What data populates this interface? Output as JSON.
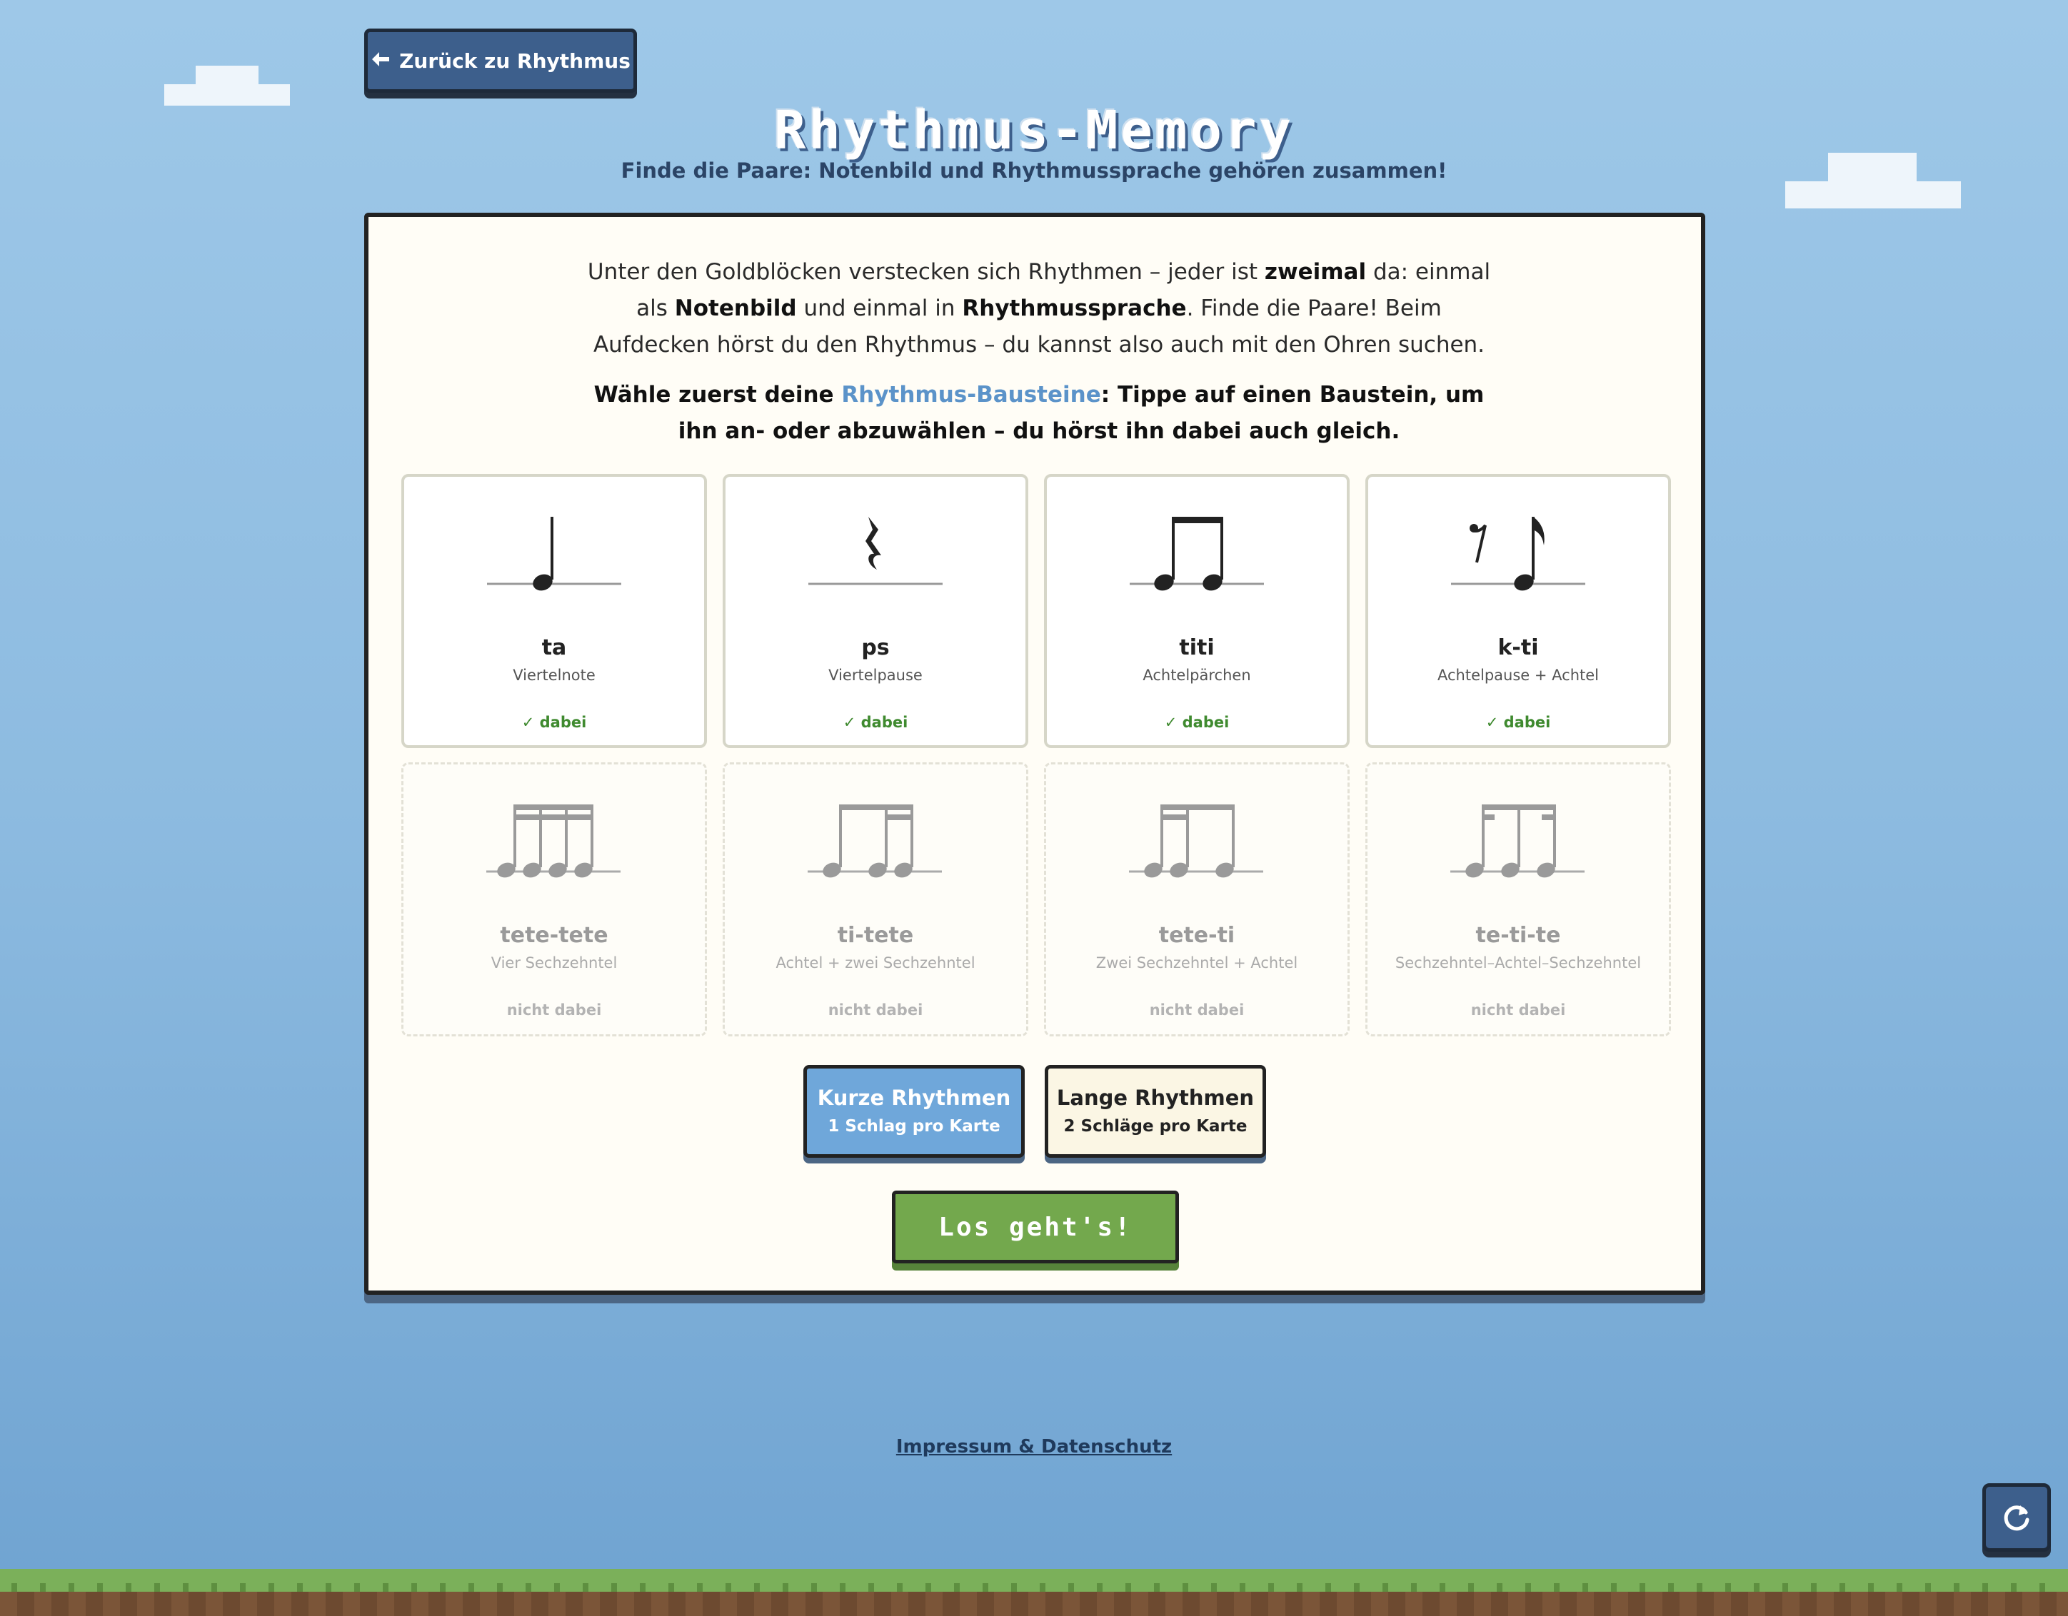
{
  "nav": {
    "back_label": "Zurück zu Rhythmus"
  },
  "header": {
    "title": "Rhythmus-Memory",
    "subtitle": "Finde die Paare: Notenbild und Rhythmussprache gehören zusammen!"
  },
  "intro": {
    "part1": "Unter den Goldblöcken verstecken sich Rhythmen – jeder ist ",
    "bold1": "zweimal",
    "part2": " da: einmal als ",
    "bold2": "Notenbild",
    "part3": " und einmal in ",
    "bold3": "Rhythmussprache",
    "part4": ". Finde die Paare! Beim Aufdecken hörst du den Rhythmus – du kannst also auch mit den Ohren suchen."
  },
  "choose": {
    "before": "Wähle zuerst deine ",
    "highlight": "Rhythmus-Bausteine",
    "after": ": Tippe auf einen Baustein, um ihn an- oder abzuwählen – du hörst ihn dabei auch gleich."
  },
  "accent_color": "#5b93c9",
  "bausteine": [
    {
      "label": "ta",
      "description": "Viertelnote",
      "status": "dabei",
      "selected": true,
      "icon": "quarter-note-icon"
    },
    {
      "label": "ps",
      "description": "Viertelpause",
      "status": "dabei",
      "selected": true,
      "icon": "quarter-rest-icon"
    },
    {
      "label": "titi",
      "description": "Achtelpärchen",
      "status": "dabei",
      "selected": true,
      "icon": "eighth-pair-icon"
    },
    {
      "label": "k-ti",
      "description": "Achtelpause + Achtel",
      "status": "dabei",
      "selected": true,
      "icon": "eighth-rest-eighth-icon"
    },
    {
      "label": "tete-tete",
      "description": "Vier Sechzehntel",
      "status": "nicht dabei",
      "selected": false,
      "icon": "four-sixteenths-icon"
    },
    {
      "label": "ti-tete",
      "description": "Achtel + zwei Sechzehntel",
      "status": "nicht dabei",
      "selected": false,
      "icon": "eighth-two-sixteenths-icon"
    },
    {
      "label": "tete-ti",
      "description": "Zwei Sechzehntel + Achtel",
      "status": "nicht dabei",
      "selected": false,
      "icon": "two-sixteenths-eighth-icon"
    },
    {
      "label": "te-ti-te",
      "description": "Sechzehntel–Achtel–Sechzehntel",
      "status": "nicht dabei",
      "selected": false,
      "icon": "sixteenth-eighth-sixteenth-icon"
    }
  ],
  "modes": {
    "short": {
      "title": "Kurze Rhythmen",
      "subtitle": "1 Schlag pro Karte",
      "active": true
    },
    "long": {
      "title": "Lange Rhythmen",
      "subtitle": "2 Schläge pro Karte",
      "active": false
    }
  },
  "start_label": "Los geht's!",
  "footer": {
    "link_label": "Impressum & Datenschutz"
  }
}
